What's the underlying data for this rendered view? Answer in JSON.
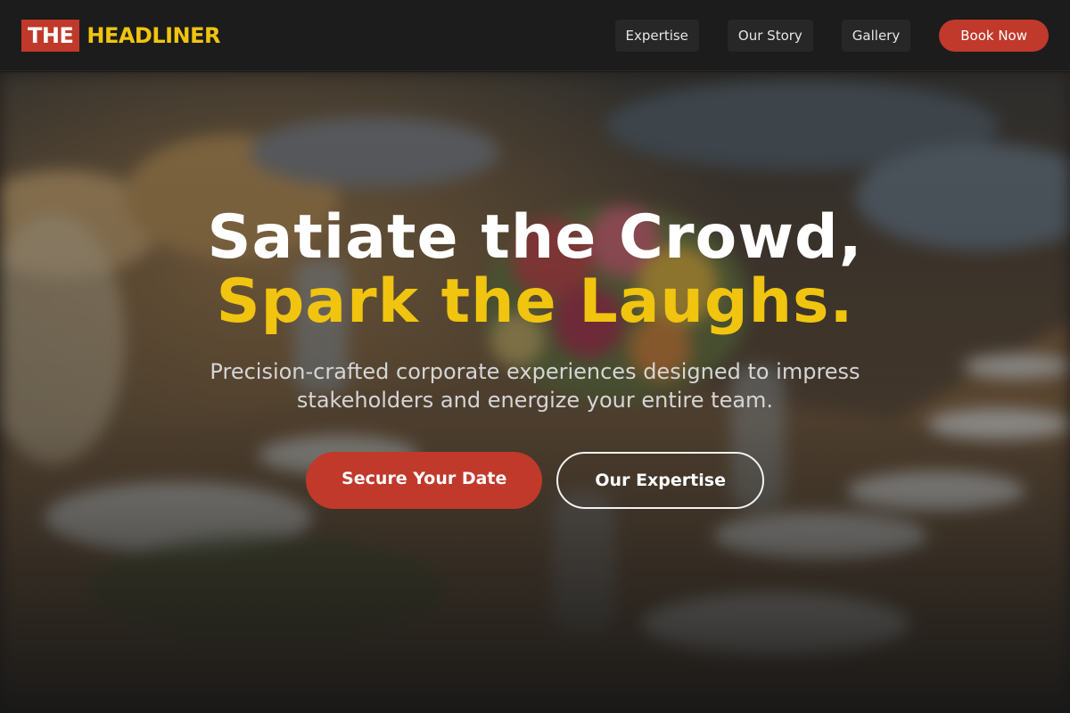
{
  "brand": {
    "prefix": "THE",
    "name": "HEADLINER",
    "prefix_bg": "#c0392b",
    "name_color": "#f1c40f"
  },
  "nav": {
    "links": [
      {
        "label": "Expertise"
      },
      {
        "label": "Our Story"
      },
      {
        "label": "Gallery"
      }
    ],
    "cta_label": "Book Now"
  },
  "hero": {
    "title_line1": "Satiate the Crowd,",
    "title_line2": "Spark the Laughs.",
    "subtitle": "Precision-crafted corporate experiences designed to impress stakeholders and energize your entire team.",
    "primary_cta": "Secure Your Date",
    "secondary_cta": "Our Expertise",
    "background_image": "blurred banquet table with flower centerpiece and place settings"
  },
  "colors": {
    "accent_red": "#c0392b",
    "accent_yellow": "#f1c40f",
    "header_bg": "#1c1c1c"
  }
}
